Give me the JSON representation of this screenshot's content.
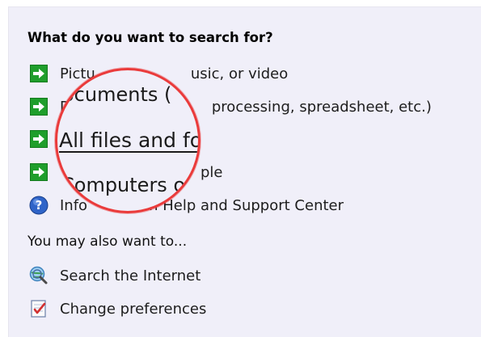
{
  "heading": "What do you want to search for?",
  "options": [
    {
      "label": "Pictures, music, or video",
      "icon": "green-arrow-icon"
    },
    {
      "label": "Documents (word processing, spreadsheet, etc.)",
      "icon": "green-arrow-icon"
    },
    {
      "label": "All files and folders",
      "icon": "green-arrow-icon"
    },
    {
      "label": "Computers or people",
      "icon": "green-arrow-icon"
    },
    {
      "label": "Information in Help and Support Center",
      "icon": "help-icon"
    }
  ],
  "visible_fragments": {
    "pictures_left": "Pictu",
    "pictures_right": "usic, or video",
    "documents_left": "D",
    "documents_right": "processing, spreadsheet, etc.)",
    "computers_right": "ple",
    "help_left": "Info",
    "help_right": "n Help and Support Center"
  },
  "magnifier": {
    "line1": "ocuments (",
    "line2": "All files and fo",
    "line3": "Computers or"
  },
  "also_heading": "You may also want to...",
  "also_items": [
    {
      "label": "Search the Internet",
      "icon": "globe-search-icon"
    },
    {
      "label": "Change preferences",
      "icon": "checklist-icon"
    }
  ],
  "colors": {
    "panel_bg": "#f0eff9",
    "arrow_green": "#1f9e2b",
    "lens_border": "#ea3b3b"
  }
}
